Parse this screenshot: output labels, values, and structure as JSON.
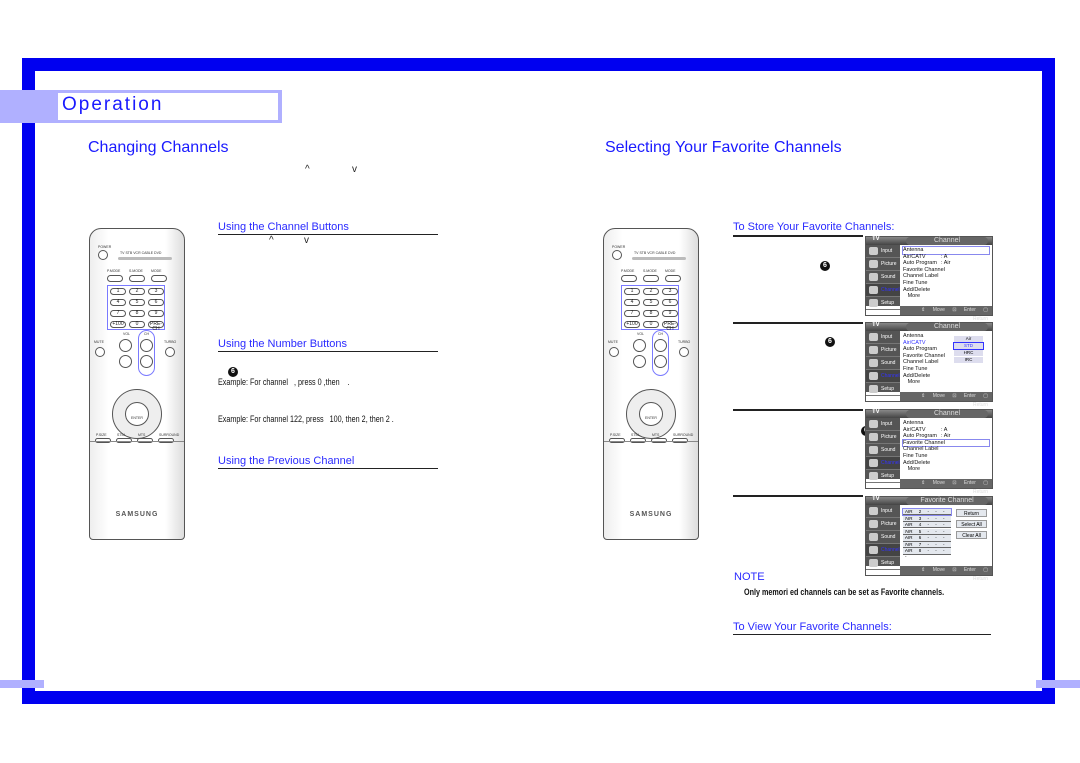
{
  "header": {
    "section": "Operation"
  },
  "left": {
    "title": "Changing Channels",
    "intro_caret_up": "^",
    "intro_caret_down": "v",
    "subsections": [
      {
        "title": "Using the Channel Buttons",
        "caret_up": "^",
        "caret_down": "v"
      },
      {
        "title": "Using the Number Buttons",
        "step": "6",
        "example1": "Example: For channel   , press 0 ,then    .",
        "example2": "Example: For channel 122, press   100, then 2, then 2 ."
      },
      {
        "title": "Using the Previous Channel"
      }
    ]
  },
  "right": {
    "title": "Selecting Your Favorite Channels",
    "store_title": "To Store Your Favorite Channels:",
    "steps": [
      "6",
      "6",
      "6"
    ],
    "note_title": "NOTE",
    "note_text": "Only memori ed channels can be set as Favorite channels.",
    "view_title": "To View Your Favorite Channels:"
  },
  "remote": {
    "power": "POWER",
    "sources": "TV STB VCR CABLE DVD",
    "modes": [
      "P.MODE",
      "S.MODE",
      "MODE"
    ],
    "keys": [
      "1",
      "2",
      "3",
      "4",
      "5",
      "6",
      "7",
      "8",
      "9",
      "+100",
      "0",
      "PRE-CH"
    ],
    "vol": "VOL",
    "ch": "CH",
    "mute": "MUTE",
    "turbo": "TURBO",
    "enter": "ENTER",
    "bottom": [
      "P.SIZE",
      "STILL",
      "MTS",
      "SURROUND"
    ],
    "brand": "SAMSUNG"
  },
  "osd": {
    "tv": "TV",
    "sidebar": [
      "Input",
      "Picture",
      "Sound",
      "Channel",
      "Setup"
    ],
    "channel_title": "Channel",
    "channel_items": [
      {
        "label": "Antenna",
        "value": ": A"
      },
      {
        "label": "Air/CATV",
        "value": ": Air"
      },
      {
        "label": "Auto Program",
        "value": ""
      },
      {
        "label": "Favorite Channel",
        "value": ""
      },
      {
        "label": "Channel Label",
        "value": ""
      },
      {
        "label": "Fine Tune",
        "value": ""
      },
      {
        "label": "Add/Delete",
        "value": ""
      },
      {
        "label": "   More",
        "value": ""
      }
    ],
    "catv_options": [
      "Air",
      "STD",
      "HRC",
      "IRC"
    ],
    "fav_title": "Favorite Channel",
    "fav_rows": [
      "AIR 2 - - - -",
      "AIR 3 - - - -",
      "AIR 4 - - - -",
      "AIR 5 - - - -",
      "AIR 6 - - - -",
      "AIR 7 - - - -",
      "AIR 8 - - - -"
    ],
    "fav_buttons": [
      "Return",
      "Select All",
      "Clear All"
    ],
    "footer": "⇕ Move  ⊡ Enter  ▢ Return"
  }
}
